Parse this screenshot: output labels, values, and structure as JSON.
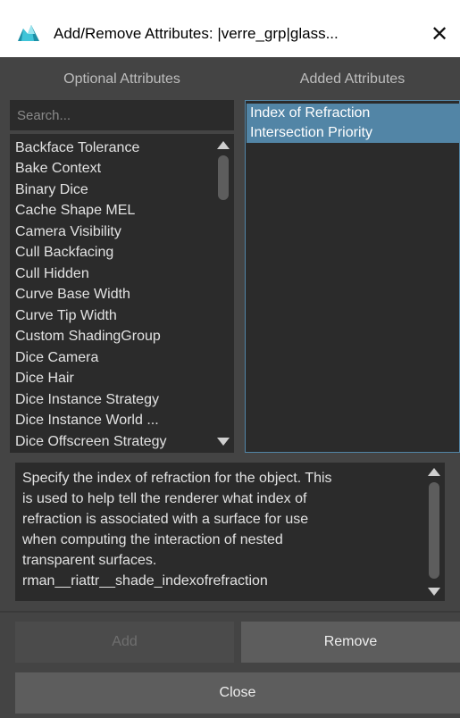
{
  "window": {
    "title": "Add/Remove Attributes: |verre_grp|glass...",
    "app_icon": "maya-icon",
    "close_glyph": "✕"
  },
  "optional": {
    "header": "Optional Attributes",
    "search_placeholder": "Search...",
    "items": [
      "Backface Tolerance",
      "Bake Context",
      "Binary Dice",
      "Cache Shape MEL",
      "Camera Visibility",
      "Cull Backfacing",
      "Cull Hidden",
      "Curve Base Width",
      "Curve Tip Width",
      "Custom ShadingGroup",
      "Dice Camera",
      "Dice Hair",
      "Dice Instance Strategy",
      "Dice Instance World ...",
      "Dice Offscreen Strategy"
    ]
  },
  "added": {
    "header": "Added Attributes",
    "items": [
      "Index of Refraction",
      "Intersection Priority"
    ]
  },
  "description": {
    "lines": [
      "Specify the index of refraction for the object. This",
      "is used to help tell the renderer what index of",
      "refraction is associated with a surface for use",
      "when computing the interaction of nested",
      "transparent surfaces.",
      "rman__riattr__shade_indexofrefraction"
    ]
  },
  "buttons": {
    "add": "Add",
    "remove": "Remove",
    "close": "Close"
  },
  "colors": {
    "selection": "#5285a6",
    "panel": "#444444",
    "field": "#2b2b2b"
  }
}
